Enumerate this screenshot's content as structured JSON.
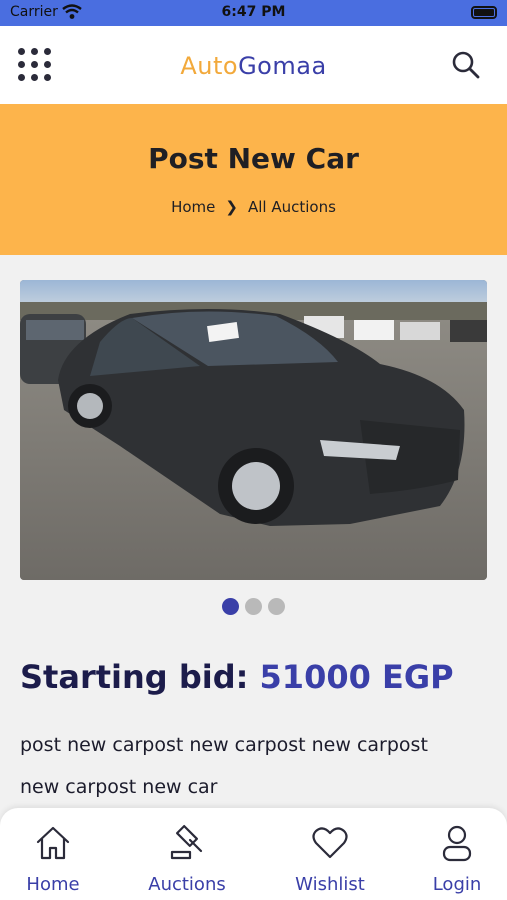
{
  "status_bar": {
    "carrier": "Carrier",
    "time": "6:47 PM"
  },
  "header": {
    "logo_part1": "Auto",
    "logo_part2": "Gomaa"
  },
  "banner": {
    "title": "Post New Car",
    "breadcrumb": [
      "Home",
      "All Auctions"
    ]
  },
  "carousel": {
    "slide_count": 3,
    "active_index": 0
  },
  "listing": {
    "bid_label": "Starting bid:",
    "bid_amount": "51000 EGP",
    "description_line1": "post new carpost new carpost new carpost",
    "description_line2": "new carpost new car"
  },
  "tabs": [
    {
      "label": "Home",
      "icon": "home-icon"
    },
    {
      "label": "Auctions",
      "icon": "gavel-icon"
    },
    {
      "label": "Wishlist",
      "icon": "heart-icon"
    },
    {
      "label": "Login",
      "icon": "user-icon"
    }
  ],
  "colors": {
    "accent": "#3a3fa8",
    "banner": "#fdb44b",
    "logo_orange": "#f2a93b",
    "status_bar": "#4a6ee0"
  }
}
